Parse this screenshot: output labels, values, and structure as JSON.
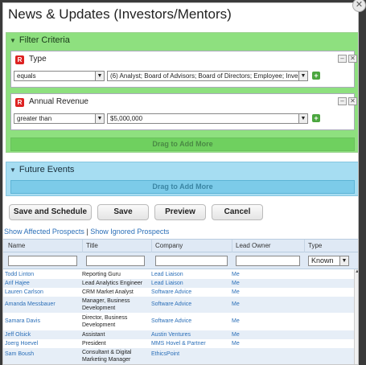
{
  "dialog": {
    "title": "News & Updates (Investors/Mentors)",
    "close_glyph": "✕"
  },
  "filter": {
    "header": "Filter Criteria",
    "criteria": [
      {
        "label": "Type",
        "operator": "equals",
        "value": "(6) Analyst; Board of Advisors; Board of Directors; Employee; Invest"
      },
      {
        "label": "Annual Revenue",
        "operator": "greater than",
        "value": "$5,000,000"
      }
    ],
    "drag_label": "Drag to Add More"
  },
  "future": {
    "header": "Future Events",
    "drag_label": "Drag to Add More"
  },
  "buttons": {
    "save_schedule": "Save and Schedule",
    "save": "Save",
    "preview": "Preview",
    "cancel": "Cancel"
  },
  "links": {
    "affected": "Show Affected Prospects",
    "separator": "|",
    "ignored": "Show Ignored Prospects"
  },
  "table": {
    "columns": [
      "Name",
      "Title",
      "Company",
      "Lead Owner",
      "Type"
    ],
    "type_filter": "Known",
    "rows": [
      {
        "name": "Todd Linton",
        "title": "Reporting Guru",
        "company": "Lead Liaison",
        "owner": "Me"
      },
      {
        "name": "Arif Hajee",
        "title": "Lead Analytics Engineer",
        "company": "Lead Liaison",
        "owner": "Me"
      },
      {
        "name": "Lauren Carlson",
        "title": "CRM Market Analyst",
        "company": "Software Advice",
        "owner": "Me"
      },
      {
        "name": "Amanda Messbauer",
        "title": "Manager, Business Development",
        "company": "Software Advice",
        "owner": "Me"
      },
      {
        "name": "Samara Davis",
        "title": "Director, Business Development",
        "company": "Software Advice",
        "owner": "Me"
      },
      {
        "name": "Jeff Olsick",
        "title": "Assistant",
        "company": "Austin Ventures",
        "owner": "Me"
      },
      {
        "name": "Joerg Hoevel",
        "title": "President",
        "company": "MMS Hovel & Partner",
        "owner": "Me"
      },
      {
        "name": "Sam Boush",
        "title": "Consultant & Digital Marketing Manager",
        "company": "EthicsPoint",
        "owner": "Me"
      }
    ]
  },
  "colors": {
    "filter_bg": "#8ee07f",
    "future_bg": "#a6ddf2",
    "link": "#2b6fb8"
  }
}
